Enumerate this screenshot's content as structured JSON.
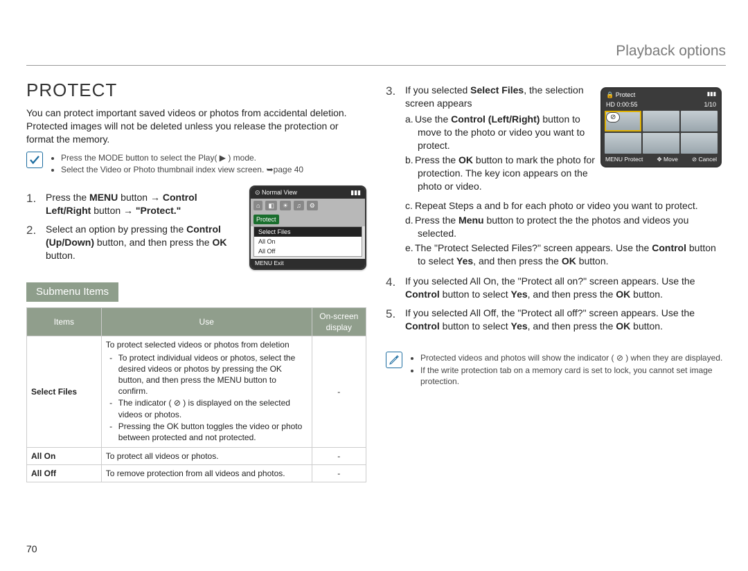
{
  "header": {
    "title": "Playback options"
  },
  "h1": "PROTECT",
  "intro": "You can protect important saved videos or photos from accidental deletion. Protected images will not be deleted unless you release the protection or format the memory.",
  "preNotes": [
    "Press the MODE button to select the Play( ▶ ) mode.",
    "Select the Video or Photo thumbnail index view screen. ➥page 40"
  ],
  "steps12": {
    "s1": {
      "num": "1.",
      "text_a": "Press the ",
      "b1": "MENU",
      "mid": " button → ",
      "b2": "Control Left/Right",
      "tail": " button → ",
      "b3": "\"Protect.\""
    },
    "s2": {
      "num": "2.",
      "text_a": "Select an option by pressing the ",
      "b1": "Control (Up/Down)",
      "mid": " button, and then press the ",
      "b2": "OK",
      "tail": " button."
    }
  },
  "lcd1": {
    "title": "Normal View",
    "tab": "Protect",
    "m1": "Select Files",
    "m2": "All On",
    "m3": "All Off",
    "footer": "MENU Exit"
  },
  "lcd2": {
    "tl": "🔒 Protect",
    "time": "HD 0:00:55",
    "count": "1/10",
    "f1": "MENU Protect",
    "f2": "✥ Move",
    "f3": "⊘ Cancel"
  },
  "submenuTitle": "Submenu Items",
  "tableHead": {
    "c1": "Items",
    "c2": "Use",
    "c3": "On-screen display"
  },
  "tableRows": {
    "r1": {
      "item": "Select Files",
      "use_lead": "To protect selected videos or photos from deletion",
      "bullets": [
        "To protect individual videos or photos, select the desired videos or photos by pressing the OK button, and then press the MENU button to confirm.",
        "The indicator ( ⊘ ) is displayed on the selected videos or photos.",
        "Pressing the OK button toggles the video or photo between protected and not protected."
      ],
      "disp": "-"
    },
    "r2": {
      "item": "All On",
      "use": "To protect all videos or photos.",
      "disp": "-"
    },
    "r3": {
      "item": "All Off",
      "use": "To remove protection from all videos and photos.",
      "disp": "-"
    }
  },
  "rightSteps": {
    "s3": {
      "num": "3.",
      "lead_a": "If you selected ",
      "b": "Select Files",
      "lead_b": ", the selection screen appears",
      "subs": {
        "a": {
          "lbl": "a.",
          "t1": "Use the ",
          "b1": "Control (Left/Right)",
          "t2": " button to move to the photo or video you want to protect."
        },
        "b": {
          "lbl": "b.",
          "t1": "Press the ",
          "b1": "OK",
          "t2": " button to mark the photo for protection. The key icon appears on the photo or video."
        },
        "c": {
          "lbl": "c.",
          "t": "Repeat Steps a and b for each photo or video you want to protect."
        },
        "d": {
          "lbl": "d.",
          "t1": "Press the ",
          "b1": "Menu",
          "t2": " button to protect the the photos and videos you selected."
        },
        "e": {
          "lbl": "e.",
          "t1": "The \"Protect Selected Files?\" screen appears. Use the ",
          "b1": "Control",
          "t2": " button to select ",
          "b2": "Yes",
          "t3": ", and then press the ",
          "b3": "OK",
          "t4": " button."
        }
      }
    },
    "s4": {
      "num": "4.",
      "t1": "If you selected All On, the \"Protect all on?\" screen appears. Use the ",
      "b1": "Control",
      "t2": " button to select ",
      "b2": "Yes",
      "t3": ", and then press the ",
      "b3": "OK",
      "t4": " button."
    },
    "s5": {
      "num": "5.",
      "t1": "If you selected All Off, the \"Protect all off?\" screen appears. Use the ",
      "b1": "Control",
      "t2": " button to select ",
      "b2": "Yes",
      "t3": ", and then press the ",
      "b3": "OK",
      "t4": " button."
    }
  },
  "infoNotes": [
    "Protected videos and photos will show the indicator ( ⊘ ) when they are displayed.",
    "If the write protection tab on a memory card is set to lock, you cannot set image protection."
  ],
  "pageNumber": "70"
}
